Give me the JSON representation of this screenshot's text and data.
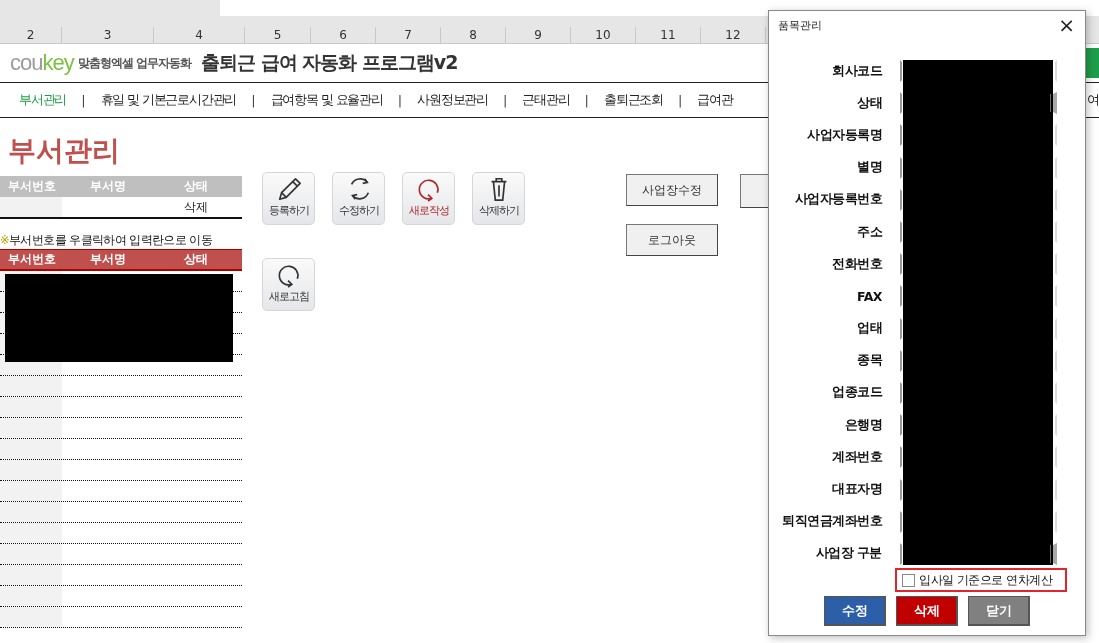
{
  "column_headers": [
    "2",
    "3",
    "4",
    "5",
    "6",
    "7",
    "8",
    "9",
    "10",
    "11",
    "12"
  ],
  "header": {
    "logo_parts": [
      {
        "text": "cou",
        "color": "#9b9b9b"
      },
      {
        "text": "key",
        "color": "#7cc242"
      }
    ],
    "tagline": "맞춤형엑셀 업무자동화",
    "title": "출퇴근 급여 자동화 프로그램v2"
  },
  "nav": {
    "separator": "|",
    "items": [
      {
        "label": "부서관리",
        "selected": true
      },
      {
        "label": "휴일 및 기본근로시간관리",
        "selected": false
      },
      {
        "label": "급여항목 및 요율관리",
        "selected": false
      },
      {
        "label": "사원정보관리",
        "selected": false
      },
      {
        "label": "근태관리",
        "selected": false
      },
      {
        "label": "출퇴근조회",
        "selected": false
      },
      {
        "label": "급여관",
        "selected": false
      }
    ],
    "trailing_item": "여"
  },
  "sheet_title": "부서관리",
  "entry_table": {
    "columns": [
      "부서번호",
      "부서명",
      "상태"
    ],
    "status": "삭제"
  },
  "note": {
    "mark": "※",
    "text": "부서번호를 우클릭하여 입력란으로 이동"
  },
  "list_table": {
    "columns": [
      "부서번호",
      "부서명",
      "상태"
    ]
  },
  "action_buttons": [
    {
      "label": "등록하기",
      "kind": "pencil",
      "accent": false
    },
    {
      "label": "수정하기",
      "kind": "sync",
      "accent": false
    },
    {
      "label": "새로작성",
      "kind": "refresh",
      "accent": true
    },
    {
      "label": "삭제하기",
      "kind": "trash",
      "accent": false
    },
    {
      "label": "새로고침",
      "kind": "refresh",
      "accent": false
    }
  ],
  "side_buttons": [
    "사업장수정",
    "로그아웃"
  ],
  "dialog": {
    "title": "품목관리",
    "close": "×",
    "fields": [
      {
        "label": "회사코드",
        "kind": "text"
      },
      {
        "label": "상태",
        "kind": "combo"
      },
      {
        "label": "사업자등록명",
        "kind": "text"
      },
      {
        "label": "별명",
        "kind": "text"
      },
      {
        "label": "사업자등록번호",
        "kind": "text"
      },
      {
        "label": "주소",
        "kind": "text"
      },
      {
        "label": "전화번호",
        "kind": "text"
      },
      {
        "label": "FAX",
        "kind": "text"
      },
      {
        "label": "업태",
        "kind": "text"
      },
      {
        "label": "종목",
        "kind": "text"
      },
      {
        "label": "업종코드",
        "kind": "text"
      },
      {
        "label": "은행명",
        "kind": "text"
      },
      {
        "label": "계좌번호",
        "kind": "text"
      },
      {
        "label": "대표자명",
        "kind": "text"
      },
      {
        "label": "퇴직연금계좌번호",
        "kind": "text"
      },
      {
        "label": "사업장 구분",
        "kind": "combo"
      }
    ],
    "checkbox": {
      "label": "입사일 기준으로 연차계산",
      "checked": false
    },
    "buttons": [
      {
        "label": "수정",
        "kind": "primary"
      },
      {
        "label": "삭제",
        "kind": "danger"
      },
      {
        "label": "닫기",
        "kind": "neutral"
      }
    ]
  }
}
